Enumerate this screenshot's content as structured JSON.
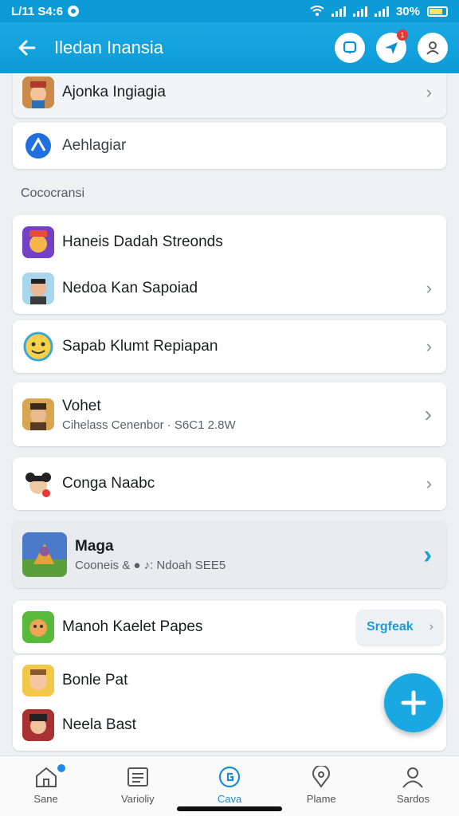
{
  "status": {
    "time": "L/11 S4:6"
  },
  "appbar": {
    "title": "Iledan Inansia"
  },
  "top_items": [
    {
      "name": "Ajonka Ingiagia"
    },
    {
      "name": "Aehlagiar"
    }
  ],
  "section": {
    "label": "Cococransi"
  },
  "group1": [
    {
      "name": "Haneis Dadah Streonds"
    },
    {
      "name": "Nedoa Kan Sapoiad"
    }
  ],
  "items": [
    {
      "name": "Sapab Klumt Repiapan"
    },
    {
      "name": "Vohet",
      "sub": "Cihelass Cenenbor · S6C1 2.8W"
    },
    {
      "name": "Conga Naabc"
    },
    {
      "name": "Maga",
      "sub": "Cooneis & ● ♪: Ndoah SEE5"
    }
  ],
  "group2": [
    {
      "name": "Manoh Kaelet Papes",
      "pill": "Srgfeak"
    },
    {
      "name": "Bonle Pat"
    },
    {
      "name": "Neela Bast"
    }
  ],
  "nav": [
    {
      "label": "Sane",
      "icon": "home-icon"
    },
    {
      "label": "Varioliy",
      "icon": "list-icon"
    },
    {
      "label": "Cava",
      "icon": "globe-icon"
    },
    {
      "label": "Plame",
      "icon": "pin-icon"
    },
    {
      "label": "Sardos",
      "icon": "person-icon"
    }
  ],
  "colors": {
    "primary": "#0d9bd8",
    "accent": "#1aa8e3"
  }
}
